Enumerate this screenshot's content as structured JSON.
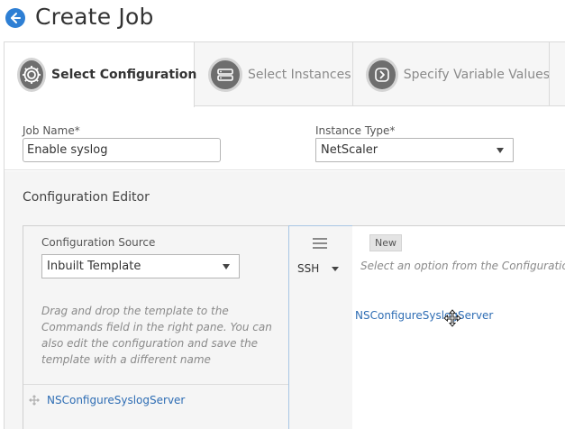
{
  "header": {
    "title": "Create Job",
    "back_icon": "arrow-left-icon",
    "accent_color": "#2e7fd4"
  },
  "tabs": [
    {
      "label": "Select Configuration",
      "icon": "gear-icon",
      "active": true
    },
    {
      "label": "Select Instances",
      "icon": "server-icon",
      "active": false
    },
    {
      "label": "Specify Variable Values",
      "icon": "chevron-right-icon",
      "active": false
    }
  ],
  "form": {
    "job_name": {
      "label": "Job Name*",
      "value": "Enable syslog"
    },
    "instance_type": {
      "label": "Instance Type*",
      "value": "NetScaler"
    }
  },
  "editor": {
    "title": "Configuration Editor",
    "source": {
      "label": "Configuration Source",
      "value": "Inbuilt Template"
    },
    "hint": "Drag and drop the template to the Commands field in the right pane. You can also edit the configuration and save the template with a different name",
    "templates": [
      {
        "label": "NSConfigureSyslogServer",
        "icon": "drag-handle-icon"
      }
    ],
    "mode": {
      "value": "SSH"
    },
    "new_label": "New",
    "placeholder": "Select an option from the Configuration Sc",
    "dropped_item": "NSConfigureSyslogServer"
  }
}
